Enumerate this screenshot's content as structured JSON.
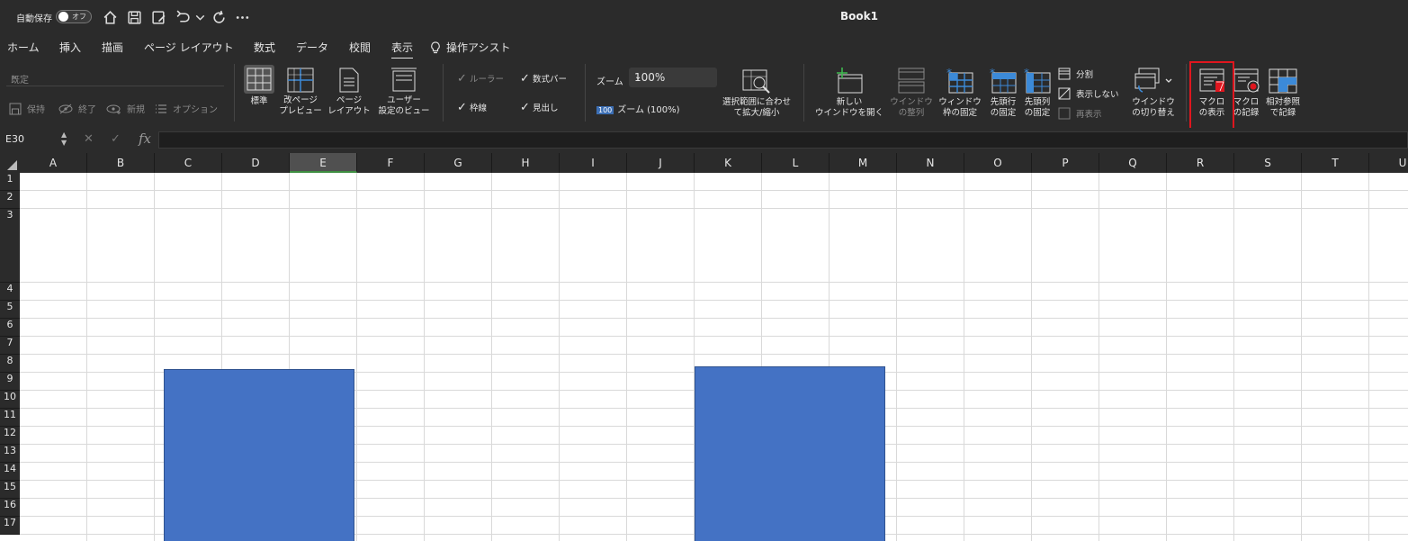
{
  "titlebar": {
    "autosave_label": "自動保存",
    "toggle_state": "オフ",
    "quick_icons": [
      "home-icon",
      "save-icon",
      "save-as-icon",
      "undo-icon",
      "undo-dropdown-icon",
      "redo-icon",
      "more-icon"
    ],
    "window_title": "Book1"
  },
  "tabs": [
    {
      "label": "ホーム"
    },
    {
      "label": "挿入"
    },
    {
      "label": "描画"
    },
    {
      "label": "ページ レイアウト"
    },
    {
      "label": "数式"
    },
    {
      "label": "データ"
    },
    {
      "label": "校閲"
    },
    {
      "label": "表示",
      "active": true
    },
    {
      "label": "操作アシスト"
    }
  ],
  "ribbon": {
    "sheet_view": {
      "style_value": "既定",
      "keep": "保持",
      "exit": "終了",
      "new": "新規",
      "options": "オプション"
    },
    "workbook_views": {
      "normal": "標準",
      "page_break_1": "改ページ",
      "page_break_2": "プレビュー",
      "page_layout_1": "ページ",
      "page_layout_2": "レイアウト",
      "custom_1": "ユーザー",
      "custom_2": "設定のビュー"
    },
    "show": {
      "ruler": "ルーラー",
      "formula_bar": "数式バー",
      "gridlines": "枠線",
      "headings": "見出し"
    },
    "zoom": {
      "label": "ズーム",
      "value": "100%",
      "badge": "100",
      "zoom100": "ズーム (100%)",
      "selection_1": "選択範囲に合わせ",
      "selection_2": "て拡大/縮小"
    },
    "window": {
      "new_window_1": "新しい",
      "new_window_2": "ウインドウを開く",
      "arrange_1": "ウインドウ",
      "arrange_2": "の整列",
      "freeze_panes_1": "ウィンドウ",
      "freeze_panes_2": "枠の固定",
      "freeze_top_1": "先頭行",
      "freeze_top_2": "の固定",
      "freeze_first_1": "先頭列",
      "freeze_first_2": "の固定",
      "split": "分割",
      "hide": "表示しない",
      "unhide": "再表示",
      "switch_1": "ウインドウ",
      "switch_2": "の切り替え"
    },
    "macros": {
      "view_1": "マクロ",
      "view_2": "の表示",
      "record_1": "マクロ",
      "record_2": "の記録",
      "relative_1": "相対参照",
      "relative_2": "で記録"
    }
  },
  "formula_bar": {
    "name_box": "E30",
    "fx": "fx",
    "content": ""
  },
  "sheet": {
    "columns": [
      "A",
      "B",
      "C",
      "D",
      "E",
      "F",
      "G",
      "H",
      "I",
      "J",
      "K",
      "L",
      "M",
      "N",
      "O",
      "P",
      "Q",
      "R",
      "S",
      "T",
      "U"
    ],
    "selected_column": "E",
    "rows": [
      "1",
      "2",
      "3",
      "4",
      "5",
      "6",
      "7",
      "8",
      "9",
      "10",
      "11",
      "12",
      "13",
      "14",
      "15",
      "16",
      "17"
    ],
    "shape_color": "#4472c4"
  },
  "colors": {
    "bg_dark": "#2b2b2b",
    "accent_blue": "#3c8ad8",
    "highlight_red": "#e0161e"
  }
}
